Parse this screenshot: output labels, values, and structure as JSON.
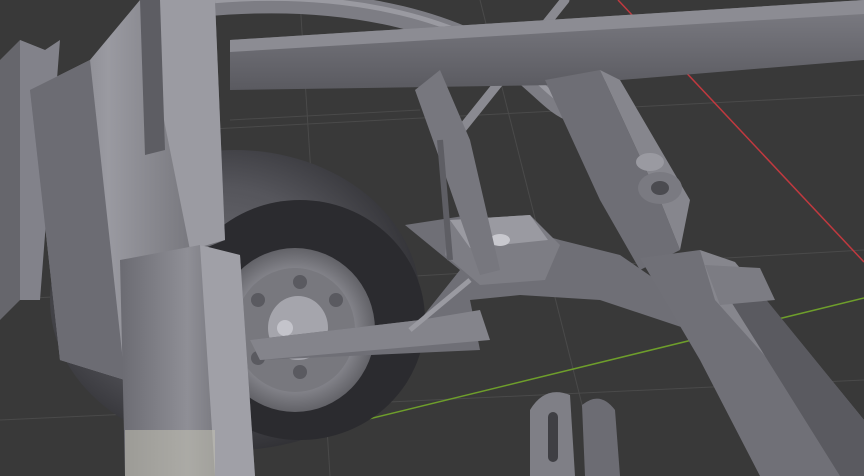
{
  "viewport": {
    "view": "3d-viewport",
    "background_color": "#393939",
    "grid_color": "#4a4a4a",
    "axis_x_color": "#c0393f",
    "axis_y_color": "#6e9e2b",
    "material_color": "#8f8f96",
    "objects": [
      "wheel",
      "tire",
      "chassis-frame",
      "steering-rod",
      "suspension-arm",
      "hub-plate",
      "leaf-spring",
      "bracket"
    ]
  }
}
